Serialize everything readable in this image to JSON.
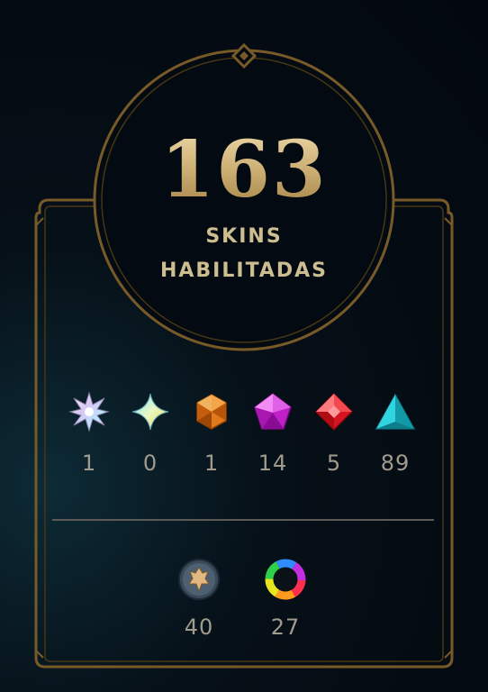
{
  "summary": {
    "total": "163",
    "label_line1": "SKINS",
    "label_line2": "HABILITADAS"
  },
  "tiers": [
    {
      "icon": "ultimate-tier-icon",
      "count": "1"
    },
    {
      "icon": "mythic-tier-icon",
      "count": "0"
    },
    {
      "icon": "legendary-tier-icon",
      "count": "1"
    },
    {
      "icon": "epic-tier-icon",
      "count": "14"
    },
    {
      "icon": "rare-tier-icon",
      "count": "5"
    },
    {
      "icon": "standard-tier-icon",
      "count": "89"
    }
  ],
  "extras": [
    {
      "icon": "legacy-skin-icon",
      "count": "40"
    },
    {
      "icon": "chroma-icon",
      "count": "27"
    }
  ],
  "colors": {
    "gold": "#c8aa6e",
    "text": "#a09b8c",
    "background": "#040b12"
  }
}
